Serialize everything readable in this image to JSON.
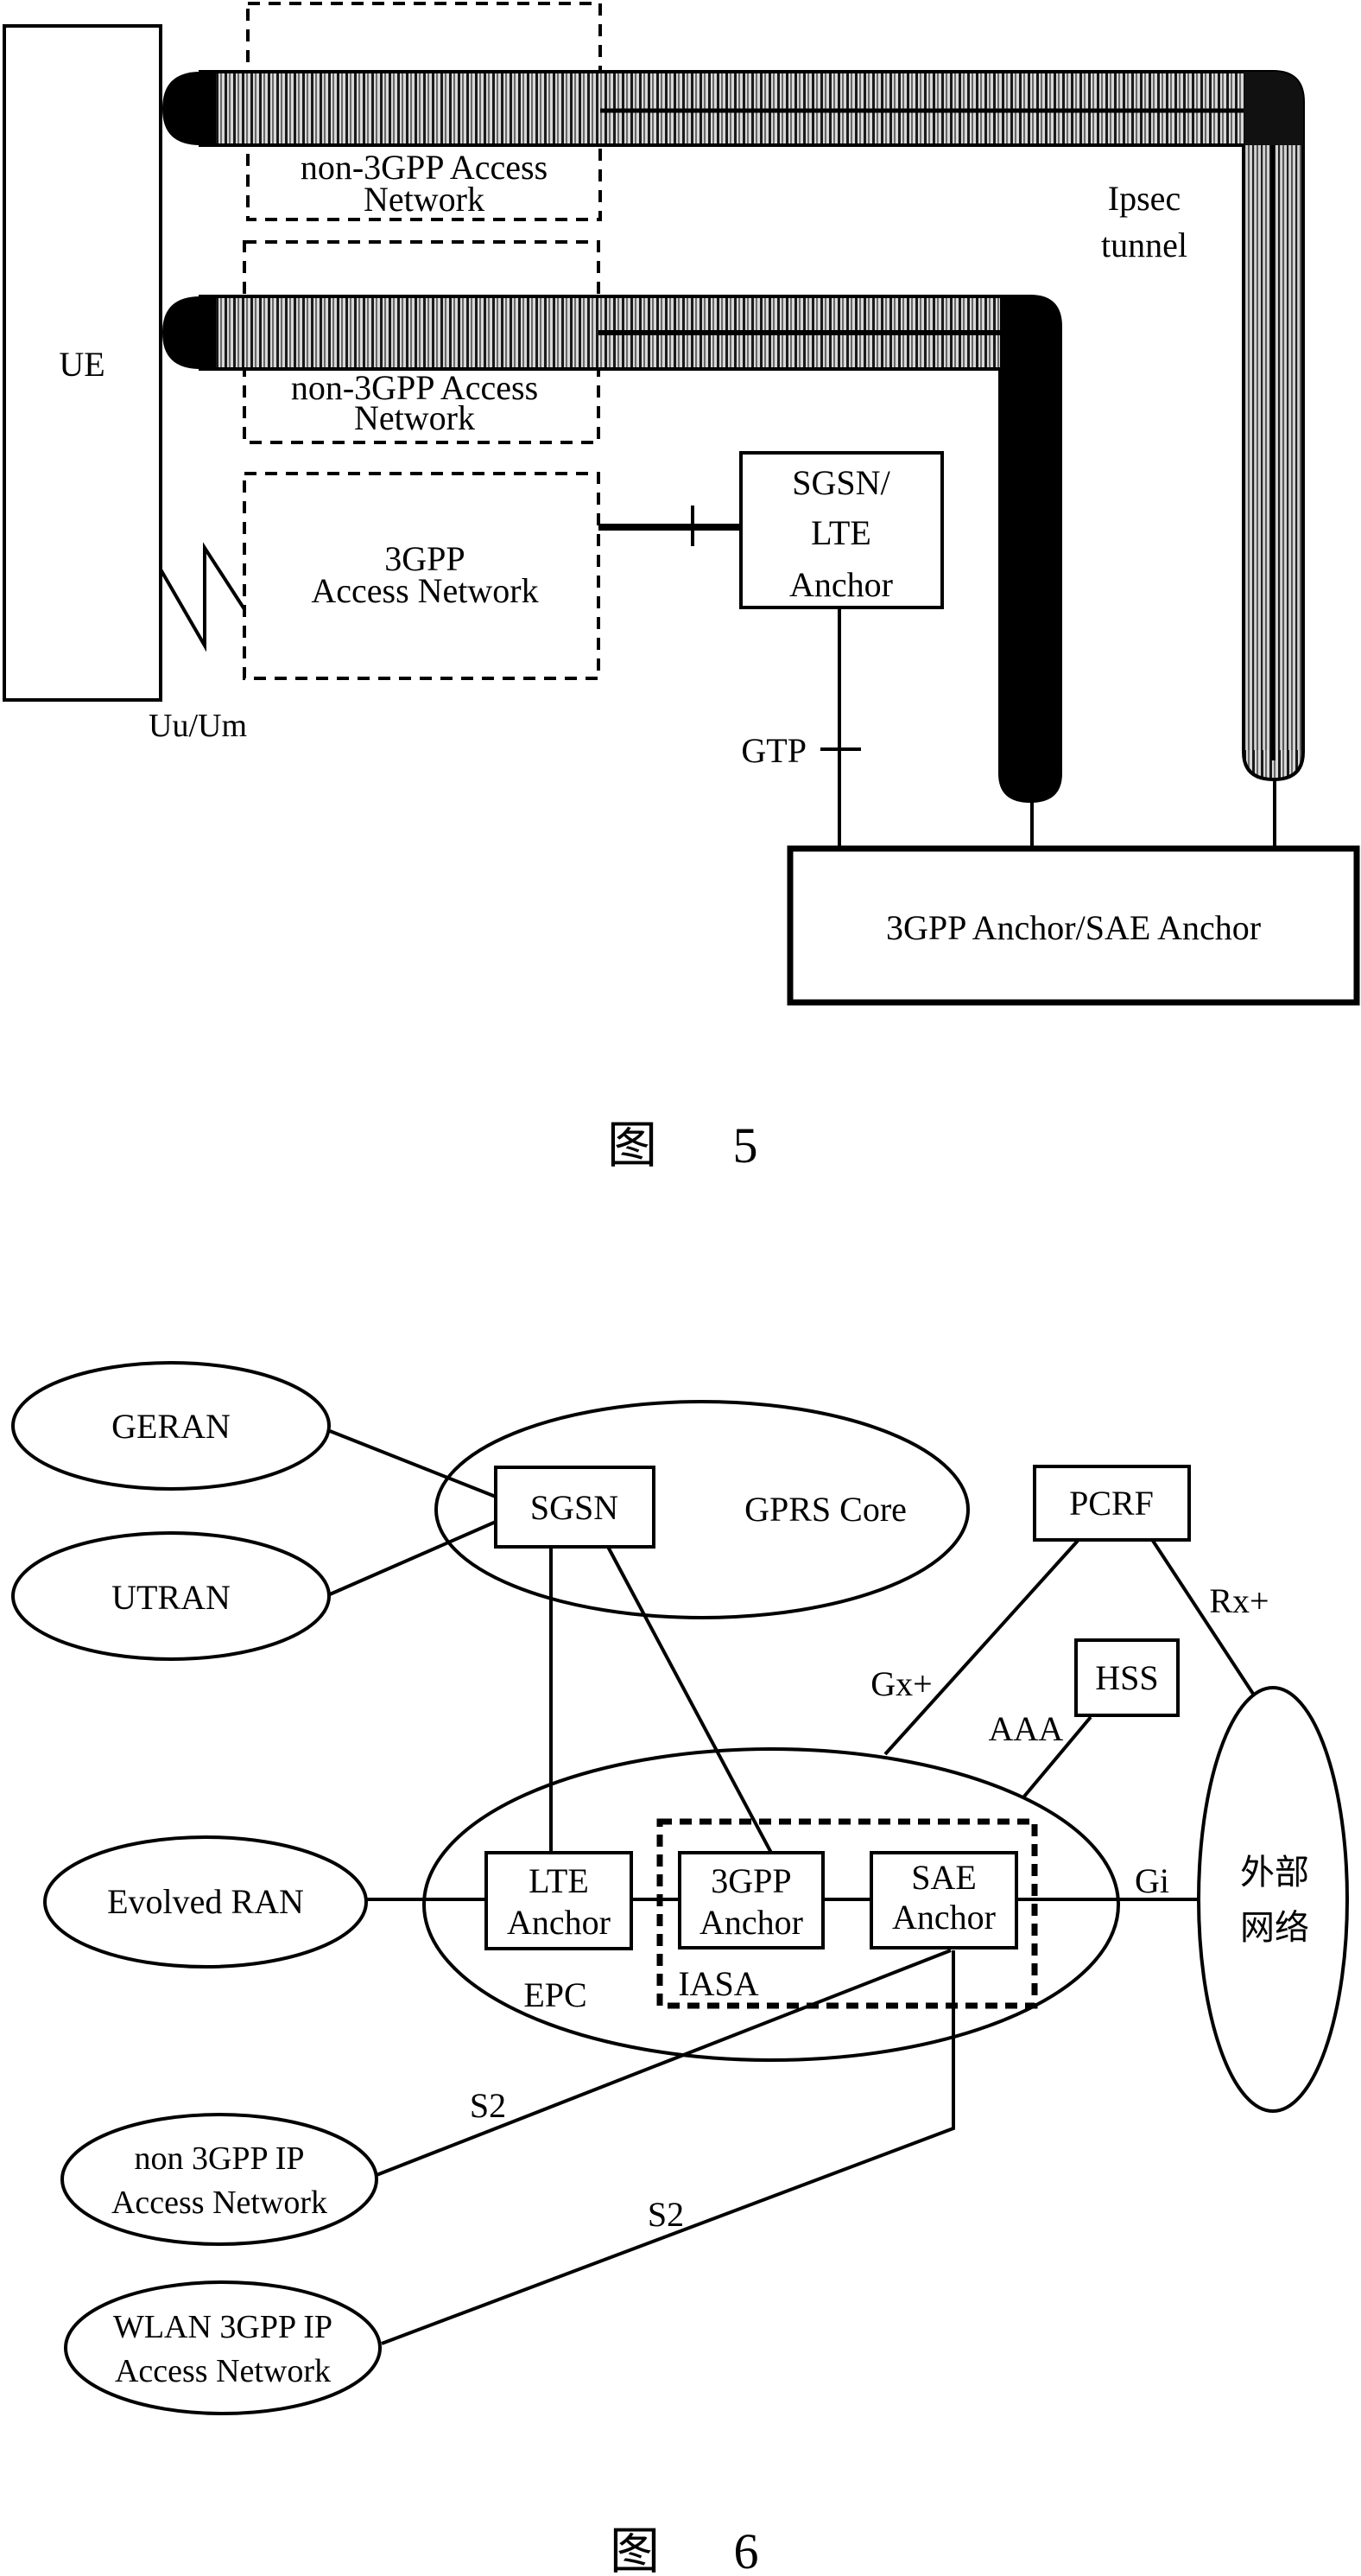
{
  "figure5": {
    "caption": {
      "prefix": "图",
      "number": "5"
    },
    "ue": {
      "label": "UE"
    },
    "access_networks": [
      {
        "line1": "non-3GPP Access",
        "line2": "Network",
        "style": "dashed"
      },
      {
        "line1": "non-3GPP Access",
        "line2": "Network",
        "style": "dashed"
      },
      {
        "line1": "3GPP",
        "line2": "Access Network",
        "style": "dashed"
      }
    ],
    "sgsn_lte_anchor": {
      "line1": "SGSN/",
      "line2": "LTE",
      "line3": "Anchor"
    },
    "anchor": {
      "label": "3GPP Anchor/SAE Anchor"
    },
    "interface_labels": {
      "radio": "Uu/Um",
      "gtp": "GTP",
      "ipsec_line1": "Ipsec",
      "ipsec_line2": "tunnel"
    },
    "tunnels": [
      {
        "from": "UE",
        "via": "non-3GPP Access Network",
        "to": "3GPP Anchor/SAE Anchor",
        "fill": "hatched-light"
      },
      {
        "from": "UE",
        "via": "non-3GPP Access Network",
        "to": "3GPP Anchor/SAE Anchor",
        "fill": "hatched-dark-vertical-solid"
      }
    ]
  },
  "figure6": {
    "caption": {
      "prefix": "图",
      "number": "6"
    },
    "ellipses": {
      "geran": "GERAN",
      "utran": "UTRAN",
      "gprs_core": "GPRS Core",
      "evolved_ran": "Evolved RAN",
      "epc": "EPC",
      "non3gpp": {
        "line1": "non 3GPP IP",
        "line2": "Access Network"
      },
      "wlan": {
        "line1": "WLAN 3GPP IP",
        "line2": "Access Network"
      },
      "external": {
        "line1": "外部",
        "line2": "网络"
      }
    },
    "boxes": {
      "sgsn": "SGSN",
      "pcrf": "PCRF",
      "hss": "HSS",
      "lte_anchor": {
        "line1": "LTE",
        "line2": "Anchor"
      },
      "gpp_anchor": {
        "line1": "3GPP",
        "line2": "Anchor"
      },
      "sae_anchor": {
        "line1": "SAE",
        "line2": "Anchor"
      },
      "iasa": "IASA"
    },
    "interfaces": {
      "gx": "Gx+",
      "rx": "Rx+",
      "aaa": "AAA",
      "gi": "Gi",
      "s2_a": "S2",
      "s2_b": "S2"
    }
  }
}
